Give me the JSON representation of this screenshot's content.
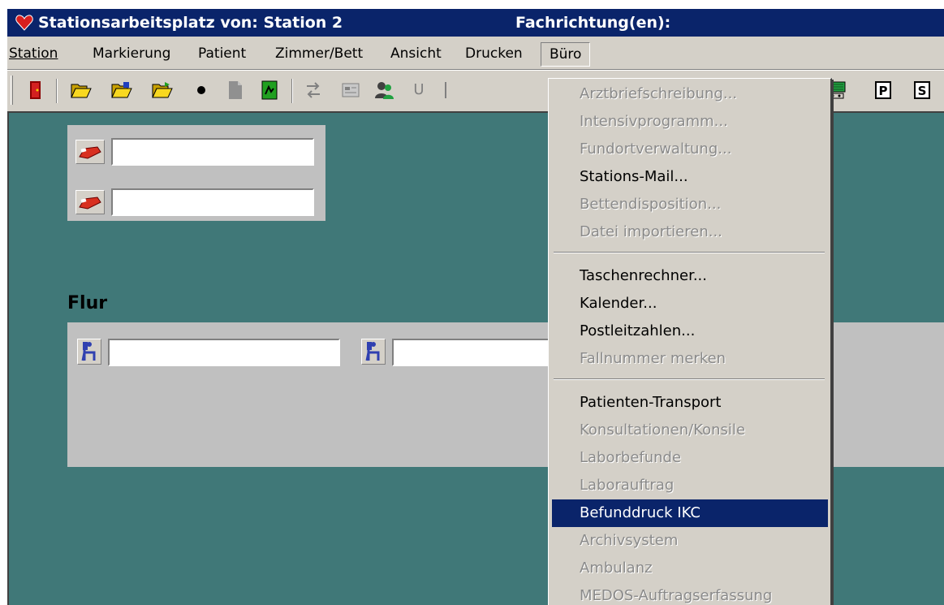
{
  "window": {
    "title": "Stationsarbeitsplatz von: Station 2",
    "title_right": "Fachrichtung(en):"
  },
  "menubar": {
    "items": [
      {
        "label": "Station"
      },
      {
        "label": "Markierung"
      },
      {
        "label": "Patient"
      },
      {
        "label": "Zimmer/Bett"
      },
      {
        "label": "Ansicht"
      },
      {
        "label": "Drucken"
      },
      {
        "label": "Büro"
      }
    ]
  },
  "toolbar": {
    "icons": [
      "exit-icon",
      "open-folder-icon",
      "open-folder-icon",
      "open-folder-icon",
      "dot-icon",
      "document-icon",
      "green-document-icon",
      "arrows-icon",
      "card-icon",
      "people-icon",
      "u-icon",
      "monitor-icon",
      "p-icon",
      "s-icon"
    ]
  },
  "dropdown": {
    "items": [
      {
        "label": "Arztbriefschreibung...",
        "state": "disabled"
      },
      {
        "label": "Intensivprogramm...",
        "state": "disabled"
      },
      {
        "label": "Fundortverwaltung...",
        "state": "disabled"
      },
      {
        "label": "Stations-Mail...",
        "state": "enabled"
      },
      {
        "label": "Bettendisposition...",
        "state": "disabled"
      },
      {
        "label": "Datei importieren...",
        "state": "disabled"
      },
      {
        "label": "Taschenrechner...",
        "state": "enabled"
      },
      {
        "label": "Kalender...",
        "state": "enabled"
      },
      {
        "label": "Postleitzahlen...",
        "state": "enabled"
      },
      {
        "label": "Fallnummer merken",
        "state": "disabled"
      },
      {
        "label": "Patienten-Transport",
        "state": "enabled"
      },
      {
        "label": "Konsultationen/Konsile",
        "state": "disabled"
      },
      {
        "label": "Laborbefunde",
        "state": "disabled"
      },
      {
        "label": "Laborauftrag",
        "state": "disabled"
      },
      {
        "label": "Befunddruck IKC",
        "state": "selected"
      },
      {
        "label": "Archivsystem",
        "state": "disabled"
      },
      {
        "label": "Ambulanz",
        "state": "disabled"
      },
      {
        "label": "MEDOS-Auftragserfassung",
        "state": "disabled"
      }
    ]
  },
  "main": {
    "flur_label": "Flur",
    "bed_fields": [
      "",
      ""
    ],
    "flur_fields": [
      "",
      ""
    ]
  },
  "colors": {
    "titlebar": "#0a246a",
    "client_bg": "#407878",
    "panel_bg": "#c0c0c0",
    "selection": "#0a246a"
  }
}
